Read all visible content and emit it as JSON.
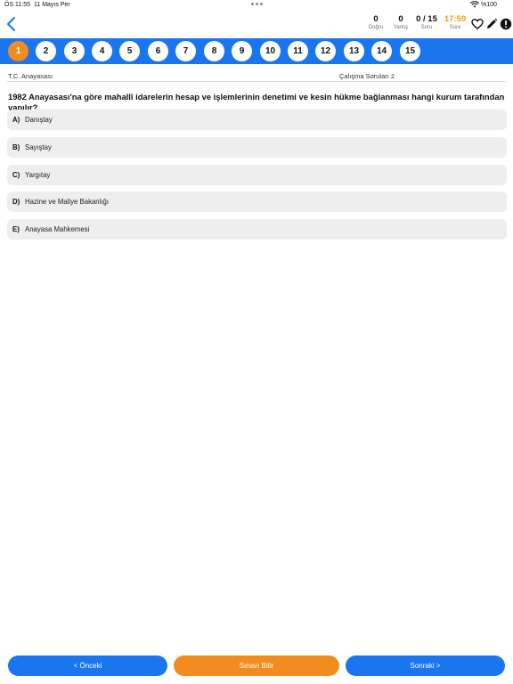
{
  "status_bar": {
    "time": "ÖS 11:55",
    "date": "11 Mayıs Per",
    "battery": "%100"
  },
  "header": {
    "stats": [
      {
        "value": "0",
        "label": "Doğru"
      },
      {
        "value": "0",
        "label": "Yanlış"
      },
      {
        "value": "0 / 15",
        "label": "Soru"
      },
      {
        "value": "17:59",
        "label": "Süre"
      }
    ]
  },
  "question_nav": {
    "numbers": [
      "1",
      "2",
      "3",
      "4",
      "5",
      "6",
      "7",
      "8",
      "9",
      "10",
      "11",
      "12",
      "13",
      "14",
      "15"
    ],
    "active": "1"
  },
  "info": {
    "subject": "T.C. Anayasası",
    "set": "Çalışma Soruları 2"
  },
  "question": {
    "text": "1982 Anayasası'na göre mahallî idarelerin hesap ve işlemlerinin denetimi ve kesin hükme bağlanması hangi kurum tarafından yapılır?",
    "options": [
      {
        "letter": "A)",
        "text": "Danıştay"
      },
      {
        "letter": "B)",
        "text": "Sayıştay"
      },
      {
        "letter": "C)",
        "text": "Yargıtay"
      },
      {
        "letter": "D)",
        "text": "Hazine ve Maliye Bakanlığı"
      },
      {
        "letter": "E)",
        "text": "Anayasa Mahkemesi"
      }
    ]
  },
  "footer": {
    "prev_label": "< Önceki",
    "finish_label": "Sınavı Bitir",
    "next_label": "Sonraki >"
  },
  "colors": {
    "accent_blue": "#1a76ee",
    "accent_orange": "#f28c1e"
  }
}
